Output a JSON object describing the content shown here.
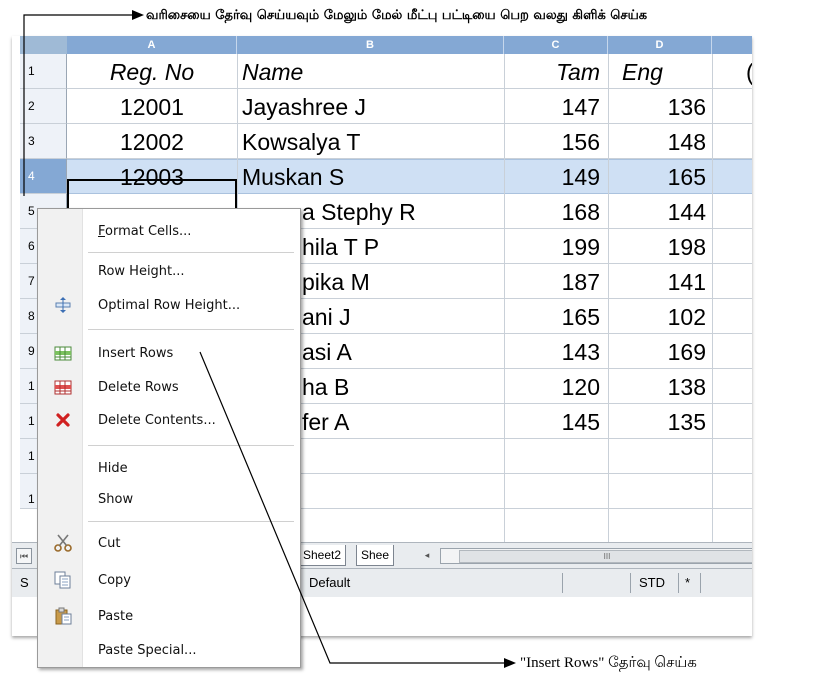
{
  "annotations": {
    "top": "வரிசையை தேர்வு செய்யவும் மேலும் மேல் மீட்பு பட்டியை பெற வலது கிளிக் செய்க",
    "bottom": "\"Insert Rows\" தேர்வு செய்க"
  },
  "columns": [
    "A",
    "B",
    "C",
    "D"
  ],
  "row_numbers": [
    "1",
    "2",
    "3",
    "4",
    "5",
    "6",
    "7",
    "8",
    "9",
    "1",
    "1",
    "1",
    "1"
  ],
  "headers": {
    "reg": "Reg. No",
    "name": "Name",
    "tam": "Tam",
    "eng": "Eng",
    "overflow": "("
  },
  "rows": [
    {
      "reg": "12001",
      "name": "Jayashree J",
      "tam": "147",
      "eng": "136"
    },
    {
      "reg": "12002",
      "name": "Kowsalya T",
      "tam": "156",
      "eng": "148"
    },
    {
      "reg": "12003",
      "name": "Muskan S",
      "tam": "149",
      "eng": "165"
    },
    {
      "reg": "",
      "name": "a Stephy R",
      "tam": "168",
      "eng": "144"
    },
    {
      "reg": "",
      "name": "hila T P",
      "tam": "199",
      "eng": "198"
    },
    {
      "reg": "",
      "name": "pika M",
      "tam": "187",
      "eng": "141"
    },
    {
      "reg": "",
      "name": "ani J",
      "tam": "165",
      "eng": "102"
    },
    {
      "reg": "",
      "name": "asi A",
      "tam": "143",
      "eng": "169"
    },
    {
      "reg": "",
      "name": "ha B",
      "tam": "120",
      "eng": "138"
    },
    {
      "reg": "",
      "name": "fer A",
      "tam": "145",
      "eng": "135"
    }
  ],
  "tabs": {
    "sheet2": "Sheet2",
    "sheet3": "Shee"
  },
  "status": {
    "first": "S",
    "style": "Default",
    "mode": "STD",
    "modified": "*"
  },
  "scroll_thumb": "III",
  "menu": {
    "format_cells": "Format Cells...",
    "row_height": "Row Height...",
    "optimal_row_height": "Optimal Row Height...",
    "insert_rows": "Insert Rows",
    "delete_rows": "Delete Rows",
    "delete_contents": "Delete Contents...",
    "hide": "Hide",
    "show": "Show",
    "cut": "Cut",
    "copy": "Copy",
    "paste": "Paste",
    "paste_special": "Paste Special..."
  },
  "colors": {
    "header_blue": "#84a8d4",
    "selection": "#cfe0f4"
  },
  "icons": [
    "optimal-row-height-icon",
    "insert-rows-icon",
    "delete-rows-icon",
    "delete-contents-icon",
    "cut-icon",
    "copy-icon",
    "paste-icon"
  ]
}
